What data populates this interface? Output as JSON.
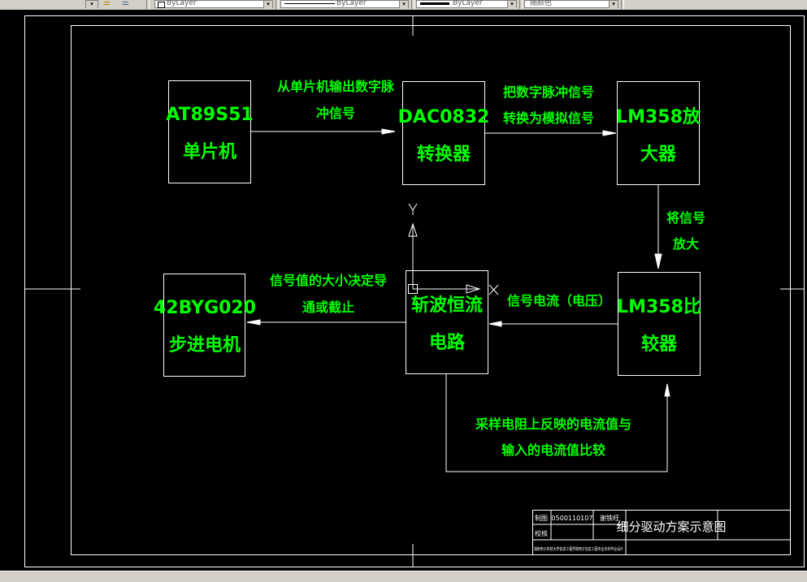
{
  "toolbar": {
    "layer_value": "ByLayer",
    "linetype_value": "ByLayer",
    "lineweight_value": "ByLayer",
    "plotstyle_value": "随颜色"
  },
  "drawing": {
    "blocks": {
      "mcu": [
        "AT89S51",
        "单片机"
      ],
      "dac": [
        "DAC0832",
        "转换器"
      ],
      "amp": [
        "LM358放",
        "大器"
      ],
      "motor": [
        "42BYG020",
        "步进电机"
      ],
      "chopper": [
        "斩波恒流",
        "电路"
      ],
      "comparator": [
        "LM358比",
        "较器"
      ]
    },
    "labels": {
      "mcu_to_dac": [
        "从单片机输出数字脉",
        "冲信号"
      ],
      "dac_to_amp": [
        "把数字脉冲信号",
        "转换为模拟信号"
      ],
      "amp_to_comp": [
        "将信号",
        "放大"
      ],
      "comp_to_chopper": "信号电流（电压）",
      "chopper_to_motor": [
        "信号值的大小决定导",
        "通或截止"
      ],
      "feedback": [
        "采样电阻上反映的电流值与",
        "输入的电流值比较"
      ]
    },
    "ucs": {
      "y_label": "Y",
      "x_label": "X"
    },
    "title_block": {
      "drawn_label": "制图",
      "drawn_value": "0500110107",
      "name": "谢铁旺",
      "checked_label": "校核",
      "title": "细分驱动方案示意图",
      "school": "湖南电子科技大学信息工程学院电子信息工程专业本科毕业设计"
    },
    "colors": {
      "text": "#00ff00",
      "lines": "#ffffff",
      "background": "#000000"
    }
  }
}
